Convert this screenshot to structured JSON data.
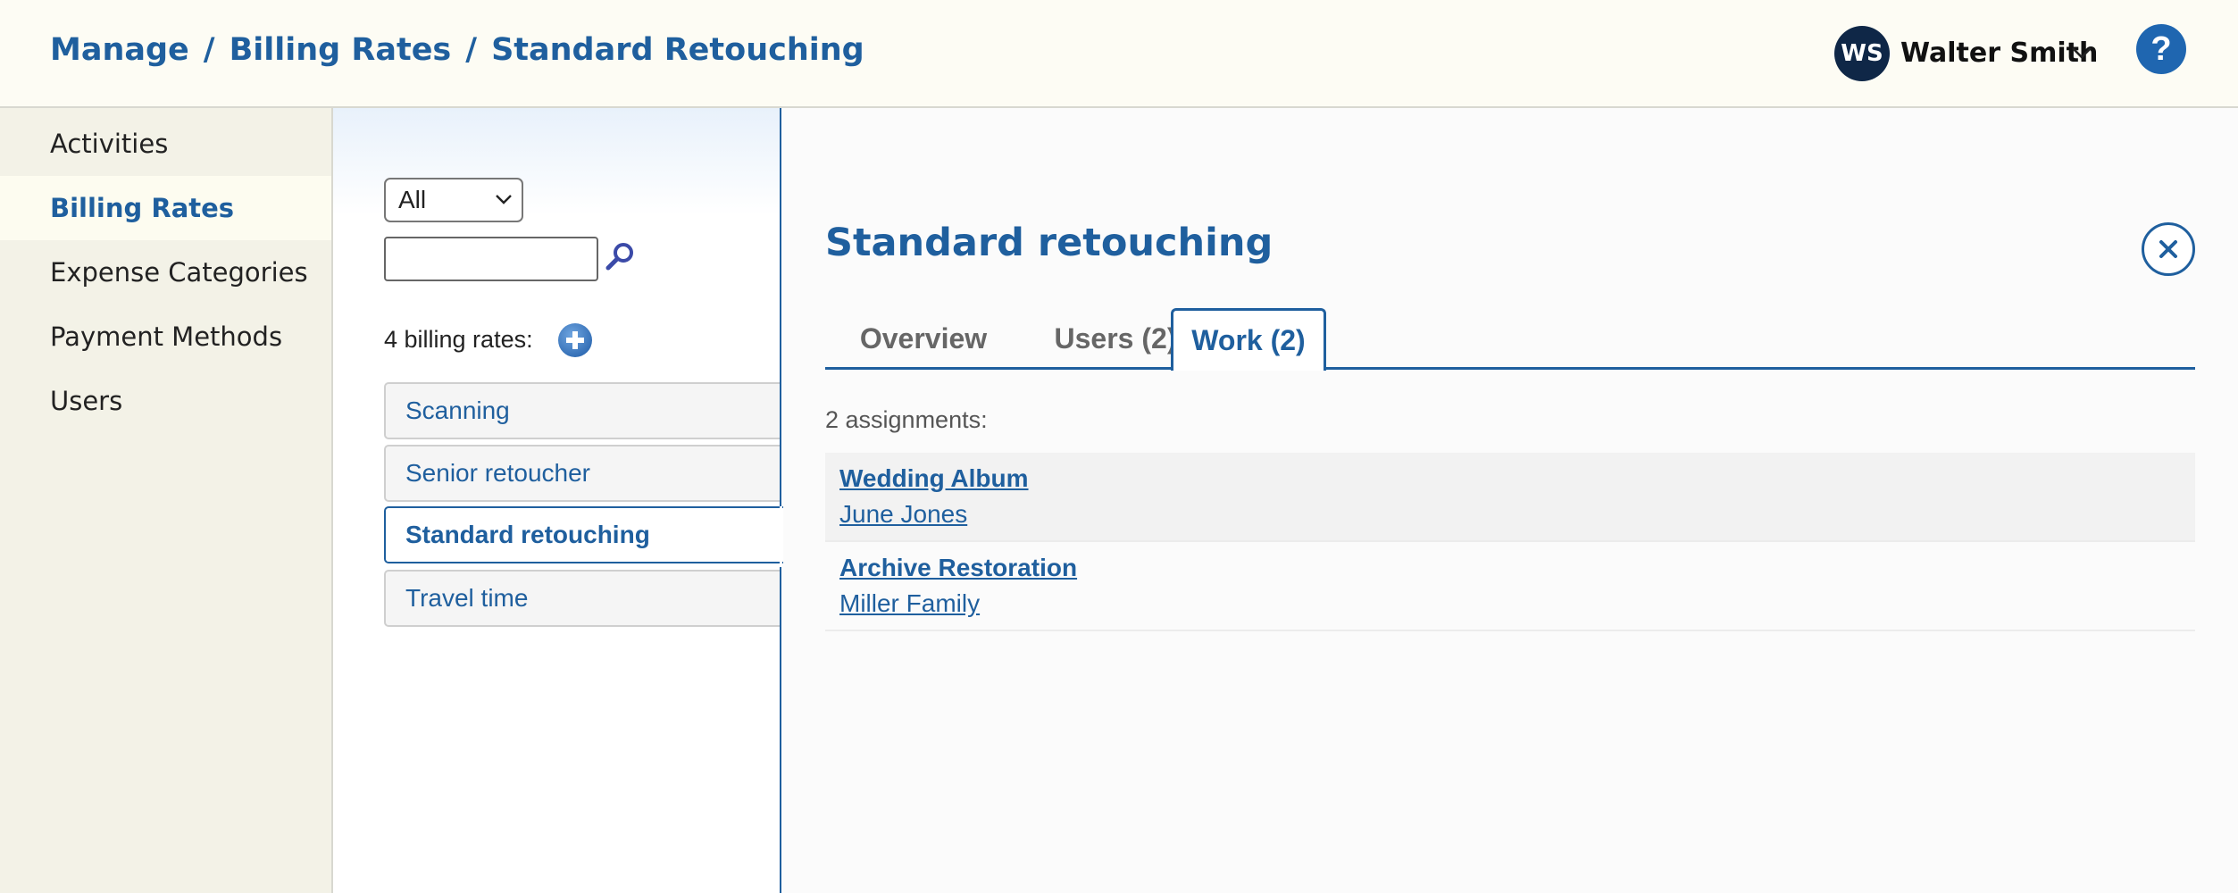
{
  "header": {
    "breadcrumb": [
      "Manage",
      "Billing Rates",
      "Standard Retouching"
    ],
    "breadcrumb_separator": "/",
    "user": {
      "initials": "WS",
      "name": "Walter Smith"
    },
    "help_label": "?"
  },
  "sidebar": {
    "items": [
      {
        "label": "Activities",
        "active": false
      },
      {
        "label": "Billing Rates",
        "active": true
      },
      {
        "label": "Expense Categories",
        "active": false
      },
      {
        "label": "Payment Methods",
        "active": false
      },
      {
        "label": "Users",
        "active": false
      }
    ]
  },
  "list": {
    "filter_selected": "All",
    "search_value": "",
    "count_label": "4 billing rates:",
    "items": [
      {
        "label": "Scanning",
        "active": false
      },
      {
        "label": "Senior retoucher",
        "active": false
      },
      {
        "label": "Standard retouching",
        "active": true
      },
      {
        "label": "Travel time",
        "active": false
      }
    ]
  },
  "detail": {
    "title": "Standard retouching",
    "tabs": [
      {
        "label": "Overview",
        "active": false
      },
      {
        "label": "Users (2)",
        "active": false
      },
      {
        "label": "Work (2)",
        "active": true
      }
    ],
    "assignments_label": "2 assignments:",
    "assignments": [
      {
        "title": "Wedding Album",
        "client": "June Jones"
      },
      {
        "title": "Archive Restoration",
        "client": "Miller Family"
      }
    ]
  },
  "colors": {
    "accent": "#1f5f9e",
    "header_bg": "#fdfcf4",
    "sidebar_bg": "#f3f2e7",
    "avatar_bg": "#0f2747"
  },
  "icons": [
    "chevron-down-icon",
    "help-icon",
    "search-icon",
    "add-icon",
    "close-icon"
  ]
}
